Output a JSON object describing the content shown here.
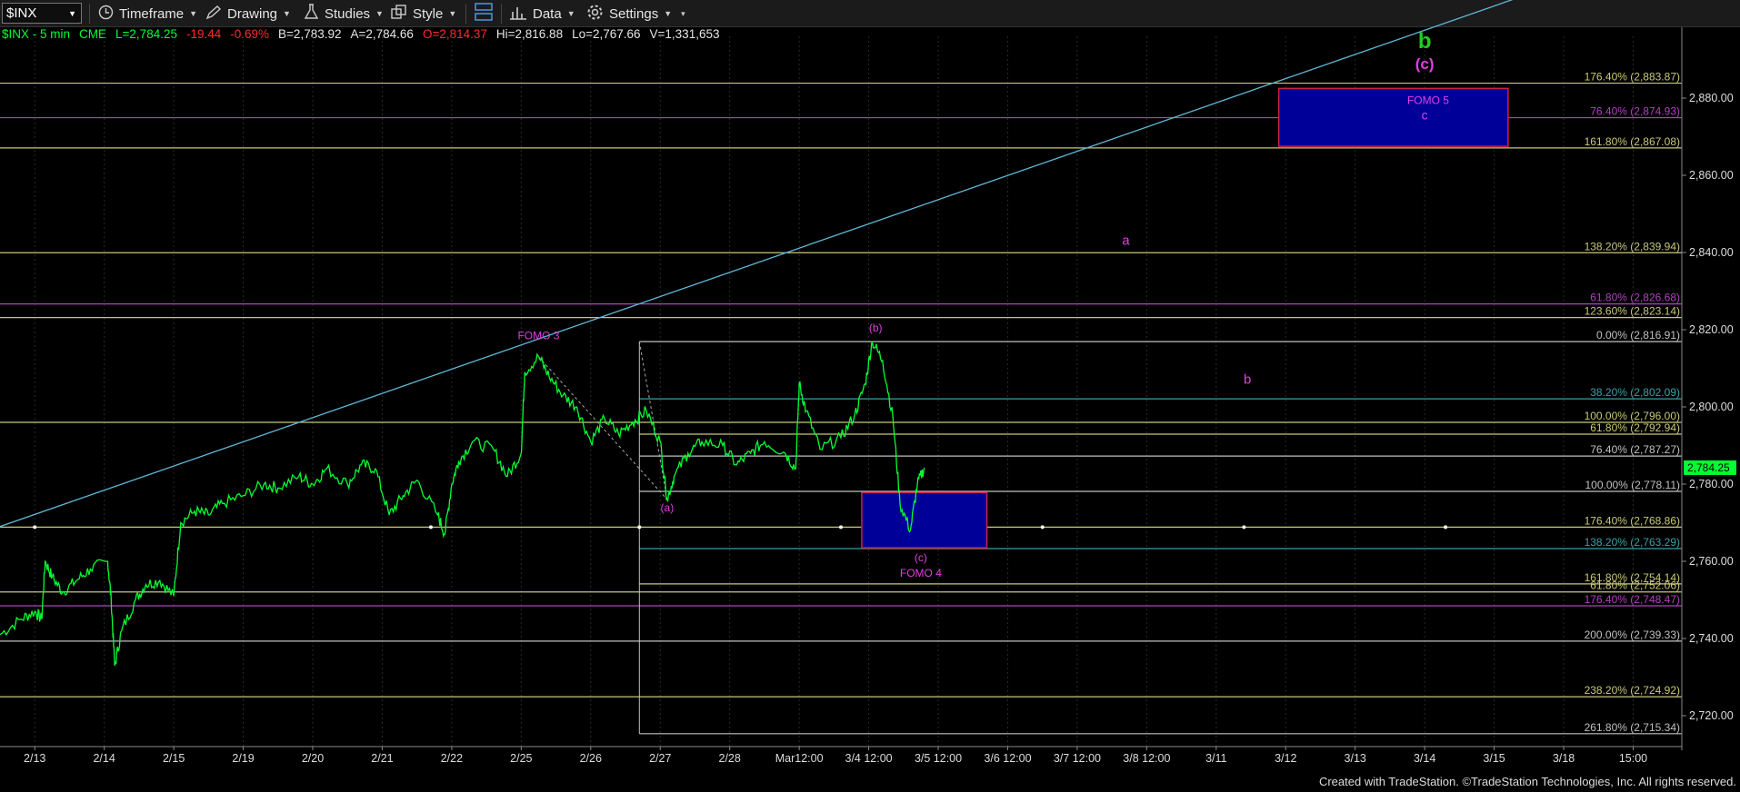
{
  "toolbar": {
    "symbol": "$INX",
    "timeframe_label": "Timeframe",
    "drawing_label": "Drawing",
    "studies_label": "Studies",
    "style_label": "Style",
    "data_label": "Data",
    "settings_label": "Settings"
  },
  "quote": {
    "symbol": "$INX - 5 min",
    "exchange": "CME",
    "last": "L=2,784.25",
    "change": "-19.44",
    "change_pct": "-0.69%",
    "bid": "B=2,783.92",
    "ask": "A=2,784.66",
    "open": "O=2,814.37",
    "high": "Hi=2,816.88",
    "low": "Lo=2,767.66",
    "volume": "V=1,331,653"
  },
  "colors": {
    "background": "#000000",
    "price": "#00ff33",
    "up_value": "#00ff33",
    "down_value": "#ff2a2a",
    "fib_yellow": "#c8c878",
    "fib_purple": "#b040c0",
    "fib_teal": "#3aa0a8",
    "fib_white": "#c0c0c0",
    "trendline": "#5fb8d8",
    "wave_label": "#e040e0",
    "wave_b_green": "#22cc22",
    "box_fill": "#000099",
    "box_border": "#cc2244"
  },
  "footer": "Created with TradeStation. ©TradeStation Technologies, Inc. All rights reserved.",
  "chart_data": {
    "type": "line",
    "title": "$INX - 5 min",
    "ylim": [
      2712,
      2896
    ],
    "y_ticks": [
      2720,
      2740,
      2760,
      2780,
      2800,
      2820,
      2840,
      2860,
      2880
    ],
    "y_tick_labels": [
      "2,720.00",
      "2,740.00",
      "2,760.00",
      "2,780.00",
      "2,800.00",
      "2,820.00",
      "2,840.00",
      "2,860.00",
      "2,880.00"
    ],
    "last_price_label": "2,784.25",
    "last_price": 2784.25,
    "x_tick_labels": [
      "2/13",
      "2/14",
      "2/15",
      "2/19",
      "2/20",
      "2/21",
      "2/22",
      "2/25",
      "2/26",
      "2/27",
      "2/28",
      "Mar12:00",
      "3/4 12:00",
      "3/5 12:00",
      "3/6 12:00",
      "3/7 12:00",
      "3/8 12:00",
      "3/11",
      "3/12",
      "3/13",
      "3/14",
      "3/15",
      "3/18",
      "15:00"
    ],
    "x_tick_index": [
      0.5,
      1.5,
      2.5,
      3.5,
      4.5,
      5.5,
      6.5,
      7.5,
      8.5,
      9.5,
      10.5,
      11.5,
      12.5,
      13.5,
      14.5,
      15.5,
      16.5,
      17.5,
      18.5,
      19.5,
      20.5,
      21.5,
      22.5,
      23.5
    ],
    "x_range": [
      0,
      24.2
    ],
    "series": [
      {
        "values": [
          [
            0,
            2741
          ],
          [
            0.3,
            2745
          ],
          [
            0.5,
            2747
          ],
          [
            0.6,
            2745
          ],
          [
            0.65,
            2760
          ],
          [
            0.75,
            2756
          ],
          [
            0.9,
            2752
          ],
          [
            1.1,
            2755
          ],
          [
            1.3,
            2758
          ],
          [
            1.55,
            2760
          ],
          [
            1.6,
            2750
          ],
          [
            1.65,
            2733
          ],
          [
            1.75,
            2742
          ],
          [
            1.95,
            2750
          ],
          [
            2.1,
            2754
          ],
          [
            2.3,
            2755
          ],
          [
            2.5,
            2751
          ],
          [
            2.6,
            2770
          ],
          [
            2.8,
            2773
          ],
          [
            3.0,
            2772
          ],
          [
            3.2,
            2775
          ],
          [
            3.5,
            2777
          ],
          [
            3.8,
            2780
          ],
          [
            4.0,
            2779
          ],
          [
            4.3,
            2782
          ],
          [
            4.5,
            2780
          ],
          [
            4.7,
            2784
          ],
          [
            5.0,
            2780
          ],
          [
            5.2,
            2785
          ],
          [
            5.4,
            2784
          ],
          [
            5.6,
            2772
          ],
          [
            5.8,
            2777
          ],
          [
            6.0,
            2781
          ],
          [
            6.3,
            2772
          ],
          [
            6.4,
            2767
          ],
          [
            6.5,
            2780
          ],
          [
            6.6,
            2786
          ],
          [
            6.8,
            2791
          ],
          [
            7.1,
            2789
          ],
          [
            7.3,
            2782
          ],
          [
            7.5,
            2788
          ],
          [
            7.55,
            2809
          ],
          [
            7.75,
            2813
          ],
          [
            7.9,
            2808
          ],
          [
            8.1,
            2803
          ],
          [
            8.3,
            2800
          ],
          [
            8.5,
            2791
          ],
          [
            8.7,
            2797
          ],
          [
            8.9,
            2793
          ],
          [
            9.1,
            2796
          ],
          [
            9.3,
            2799
          ],
          [
            9.5,
            2791
          ],
          [
            9.6,
            2776
          ],
          [
            9.7,
            2782
          ],
          [
            9.9,
            2788
          ],
          [
            10.1,
            2791
          ],
          [
            10.4,
            2790
          ],
          [
            10.6,
            2785
          ],
          [
            10.8,
            2788
          ],
          [
            11.0,
            2791
          ],
          [
            11.3,
            2788
          ],
          [
            11.45,
            2784
          ],
          [
            11.5,
            2806
          ],
          [
            11.6,
            2799
          ],
          [
            11.8,
            2789
          ],
          [
            12.1,
            2792
          ],
          [
            12.3,
            2798
          ],
          [
            12.45,
            2806
          ],
          [
            12.55,
            2817
          ],
          [
            12.7,
            2812
          ],
          [
            12.85,
            2797
          ],
          [
            12.95,
            2775
          ],
          [
            13.1,
            2768
          ],
          [
            13.2,
            2780
          ],
          [
            13.3,
            2784.25
          ]
        ]
      }
    ],
    "trendline": [
      [
        0,
        2769
      ],
      [
        22,
        2907
      ]
    ],
    "fib_levels": [
      {
        "label": "176.40% (2,883.87)",
        "value": 2883.87,
        "color": "fib_yellow",
        "start": 0
      },
      {
        "label": "76.40% (2,874.93)",
        "value": 2874.93,
        "color": "fib_purple",
        "start": 0
      },
      {
        "label": "161.80% (2,867.08)",
        "value": 2867.08,
        "color": "fib_yellow",
        "start": 0
      },
      {
        "label": "138.20% (2,839.94)",
        "value": 2839.94,
        "color": "fib_yellow",
        "start": 0
      },
      {
        "label": "61.80% (2,826.68)",
        "value": 2826.68,
        "color": "fib_purple",
        "start": 0
      },
      {
        "label": "123.60% (2,823.14)",
        "value": 2823.14,
        "color": "fib_yellow",
        "start": 0
      },
      {
        "label": "0.00% (2,816.91)",
        "value": 2816.91,
        "color": "fib_white",
        "start": 9.2
      },
      {
        "label": "38.20% (2,802.09)",
        "value": 2802.09,
        "color": "fib_teal",
        "start": 9.2
      },
      {
        "label": "100.00% (2,796.00)",
        "value": 2796.0,
        "color": "fib_yellow",
        "start": 0
      },
      {
        "label": "61.80% (2,792.94)",
        "value": 2792.94,
        "color": "fib_yellow",
        "start": 9.2
      },
      {
        "label": "76.40% (2,787.27)",
        "value": 2787.27,
        "color": "fib_white",
        "start": 9.2
      },
      {
        "label": "100.00% (2,778.11)",
        "value": 2778.11,
        "color": "fib_white",
        "start": 9.2
      },
      {
        "label": "176.40% (2,768.86)",
        "value": 2768.86,
        "color": "fib_yellow",
        "start": 0
      },
      {
        "label": "138.20% (2,763.29)",
        "value": 2763.29,
        "color": "fib_teal",
        "start": 9.2
      },
      {
        "label": "161.80% (2,754.14)",
        "value": 2754.14,
        "color": "fib_yellow",
        "start": 9.2
      },
      {
        "label": "61.80% (2,752.06)",
        "value": 2752.06,
        "color": "fib_yellow",
        "start": 0
      },
      {
        "label": "176.40% (2,748.47)",
        "value": 2748.47,
        "color": "fib_purple",
        "start": 0
      },
      {
        "label": "200.00% (2,739.33)",
        "value": 2739.33,
        "color": "fib_white",
        "start": 0
      },
      {
        "label": "238.20% (2,724.92)",
        "value": 2724.92,
        "color": "fib_yellow",
        "start": 0
      },
      {
        "label": "261.80% (2,715.34)",
        "value": 2715.34,
        "color": "fib_white",
        "start": 9.2
      }
    ],
    "boxes": [
      {
        "name": "fomo5-target-box",
        "x0": 18.4,
        "x1": 21.7,
        "y0": 2867.5,
        "y1": 2882.5
      },
      {
        "name": "fomo4-target-box",
        "x0": 12.4,
        "x1": 14.2,
        "y0": 2763.5,
        "y1": 2777.8
      }
    ],
    "wave_labels": [
      {
        "text": "b",
        "x": 20.5,
        "y": 2893,
        "color": "wave_b_green",
        "size": 24,
        "bold": true
      },
      {
        "text": "(c)",
        "x": 20.5,
        "y": 2887.5,
        "color": "wave_label",
        "size": 17,
        "bold": true
      },
      {
        "text": "FOMO 5",
        "x": 20.55,
        "y": 2878.5,
        "color": "wave_label",
        "size": 12
      },
      {
        "text": "c",
        "x": 20.5,
        "y": 2874.5,
        "color": "wave_label",
        "size": 14
      },
      {
        "text": "a",
        "x": 16.2,
        "y": 2842,
        "color": "wave_label",
        "size": 15
      },
      {
        "text": "b",
        "x": 17.95,
        "y": 2806,
        "color": "wave_label",
        "size": 15
      },
      {
        "text": "FOMO 3",
        "x": 7.75,
        "y": 2817.5,
        "color": "wave_label",
        "size": 12
      },
      {
        "text": "(b)",
        "x": 12.6,
        "y": 2819.5,
        "color": "wave_label",
        "size": 12
      },
      {
        "text": "(a)",
        "x": 9.6,
        "y": 2773,
        "color": "wave_label",
        "size": 12
      },
      {
        "text": "(c)",
        "x": 13.25,
        "y": 2760,
        "color": "wave_label",
        "size": 12
      },
      {
        "text": "FOMO 4",
        "x": 13.25,
        "y": 2756,
        "color": "wave_label",
        "size": 12
      }
    ]
  }
}
